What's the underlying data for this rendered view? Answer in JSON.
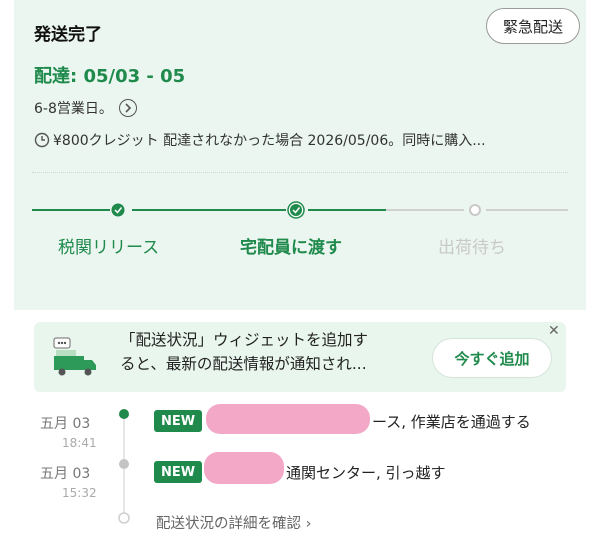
{
  "header": {
    "status_title": "発送完了",
    "urgent_button": "緊急配送",
    "delivery_date": "配達: 05/03 - 05",
    "business_days": "6-8営業日。",
    "credit_note": "¥800クレジット 配達されなかった場合 2026/05/06。同時に購入..."
  },
  "progress": {
    "steps": [
      {
        "label": "税関リリース",
        "state": "done"
      },
      {
        "label": "宅配員に渡す",
        "state": "current"
      },
      {
        "label": "出荷待ち",
        "state": "pending"
      }
    ]
  },
  "widget_banner": {
    "line1": "「配送状況」ウィジェットを追加す",
    "line2": "ると、最新の配送情報が通知され...",
    "add_button": "今すぐ追加"
  },
  "timeline": {
    "events": [
      {
        "date": "五月 03",
        "time": "18:41",
        "badge": "NEW",
        "text": "ース, 作業店を通過する"
      },
      {
        "date": "五月 03",
        "time": "15:32",
        "badge": "NEW",
        "text": "通関センター, 引っ越す"
      }
    ],
    "detail_link": "配送状況の詳細を確認 ›"
  },
  "colors": {
    "accent": "#1f8a4c",
    "panel_bg": "#eaf6ef",
    "inactive": "#c9c9c9"
  }
}
